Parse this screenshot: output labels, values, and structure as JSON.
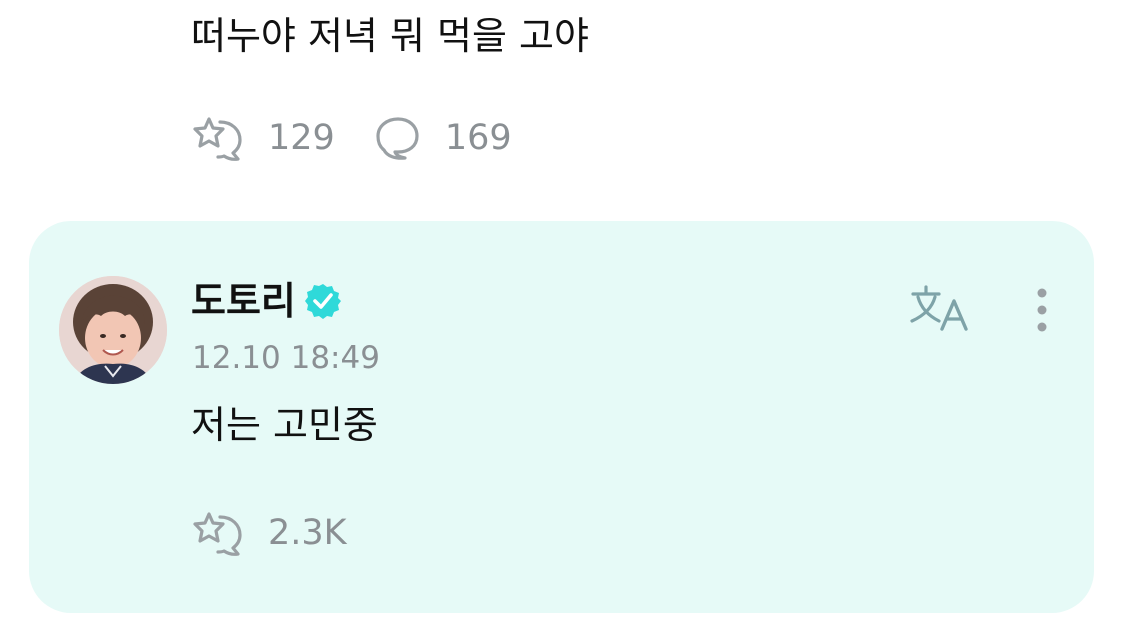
{
  "parent_post": {
    "text": "떠누야 저녁 뭐 먹을 고야",
    "likes_count": "129",
    "comments_count": "169"
  },
  "reply": {
    "author_name": "도토리",
    "timestamp": "12.10 18:49",
    "text": "저는 고민중",
    "likes_count": "2.3K"
  },
  "icons": {
    "like": "star-bubble-icon",
    "comment": "speech-bubble-icon",
    "verified": "verified-badge-icon",
    "translate": "translate-icon",
    "more": "more-vertical-icon"
  },
  "colors": {
    "card_background": "#e6faf7",
    "verified": "#2fd9d9",
    "muted_text": "#8a8f93",
    "icon_gray": "#9aa0a4",
    "icon_teal_gray": "#7ea3a8"
  }
}
